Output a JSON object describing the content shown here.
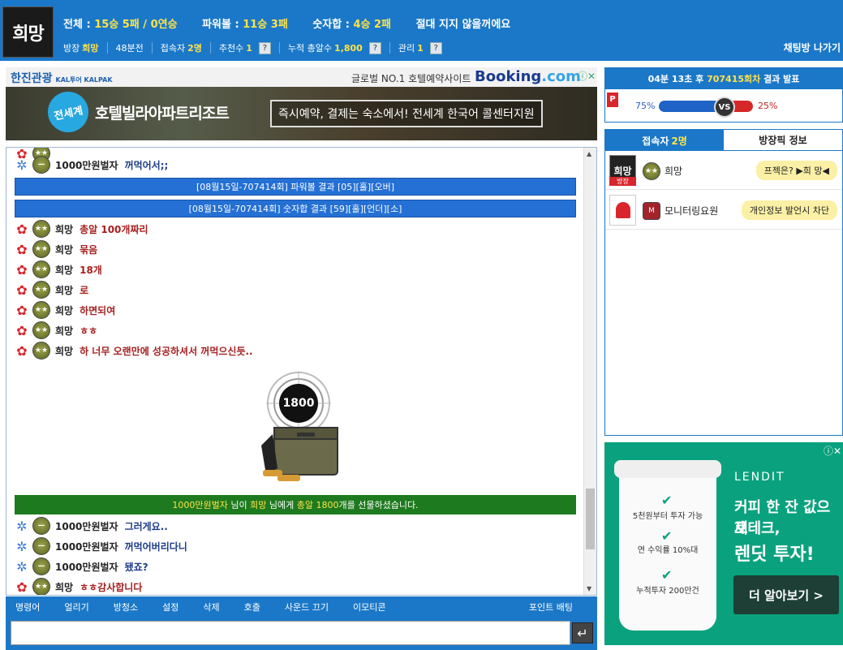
{
  "header": {
    "logo": "희망",
    "stats": {
      "total_label": "전체 :",
      "total_value": "15승 5패 / 0연승",
      "powerball_label": "파워볼 :",
      "powerball_value": "11승 3패",
      "sum_label": "숫자합 :",
      "sum_value": "4승 2패",
      "motto": "절대 지지 않을꺼에요"
    },
    "sub": {
      "host_label": "방장",
      "host_value": "희망",
      "game_label": "48분전",
      "users_label": "접속자",
      "users_value": "2명",
      "rec_label": "추천수",
      "rec_value": "1",
      "gift_label": "누적 총알수",
      "gift_value": "1,800",
      "admin_label": "관리",
      "admin_value": "1",
      "help": "?"
    },
    "exit_label": "채팅방 나가기"
  },
  "ad_top": {
    "brand": "한진관광",
    "brand_sub": "KAL투어 KALPAK",
    "slogan": "글로벌 NO.1 호텔예약사이트",
    "booking": "Booking",
    "booking_dot": ".com",
    "badge": "전세계",
    "hotel_text": "호텔빌라아파트리조트",
    "box_text": "즉시예약, 결제는 숙소에서! 전세계 한국어 콜센터지원"
  },
  "chat": {
    "messages": [
      {
        "name": "1000만원벌자",
        "text": "꺼먹어서;;",
        "blue": true
      },
      {
        "sys": "[08월15일-707414회] 파워볼 결과 [05][홀][오버]"
      },
      {
        "sys": "[08월15일-707414회] 숫자합 결과 [59][홀][언더][소]"
      },
      {
        "name": "희망",
        "text": "총알 100개짜리"
      },
      {
        "name": "희망",
        "text": "묶음"
      },
      {
        "name": "희망",
        "text": "18개"
      },
      {
        "name": "희망",
        "text": "로"
      },
      {
        "name": "희망",
        "text": "하면되여"
      },
      {
        "name": "희망",
        "text": "ㅎㅎ"
      },
      {
        "name": "희망",
        "text": "하 너무 오랜만에 성공하셔서 꺼먹으신듯.."
      }
    ],
    "gift_amount": "1800",
    "gift_notice": {
      "from": "1000만원벌자",
      "mid1": " 님이 ",
      "to": "희망",
      "mid2": " 님에게 ",
      "item": "총알 1800",
      "end": "개를 선물하셨습니다."
    },
    "after": [
      {
        "name": "1000만원벌자",
        "text": "그러게요..",
        "blue": true
      },
      {
        "name": "1000만원벌자",
        "text": "꺼먹어버리다니",
        "blue": true
      },
      {
        "name": "1000만원벌자",
        "text": "됐죠?",
        "blue": true
      },
      {
        "name": "희망",
        "text": "ㅎㅎ감사합니다"
      }
    ]
  },
  "toolbar": {
    "items": [
      "명령어",
      "얼리기",
      "방청소",
      "설정",
      "삭제",
      "호출",
      "사운드 끄기",
      "이모티콘"
    ],
    "point": "포인트 배팅"
  },
  "input": {
    "placeholder": ""
  },
  "result": {
    "title_pre": "04분 13초 후 ",
    "round": "707415회차",
    "title_post": " 결과 발표",
    "p": "P",
    "left_pct": "75%",
    "right_pct": "25%",
    "vs": "VS"
  },
  "panel": {
    "tab_users": "접속자",
    "tab_users_count": "2명",
    "tab_pick": "방장픽 정보",
    "users": [
      {
        "pic": "희망",
        "role": "방장",
        "name": "희망",
        "bubble": "프젝은? ▶희 망◀"
      },
      {
        "name": "모니터링요원",
        "bubble": "개인정보 발언시 차단",
        "lv": "M"
      }
    ]
  },
  "ad_right": {
    "brand": "LENDIT",
    "line1": "커피 한 잔 값으로",
    "line2": "재테크,",
    "line3": "렌딧 투자!",
    "cta": "더 알아보기 >",
    "cup1": "5천원부터 투자 가능",
    "cup2": "연 수익률 10%대",
    "cup3": "누적투자 200만건"
  },
  "colors": {
    "header": "#1b78c8",
    "accent": "#ffe34a",
    "sys": "#2470d4",
    "gift": "#1e7a1e"
  }
}
